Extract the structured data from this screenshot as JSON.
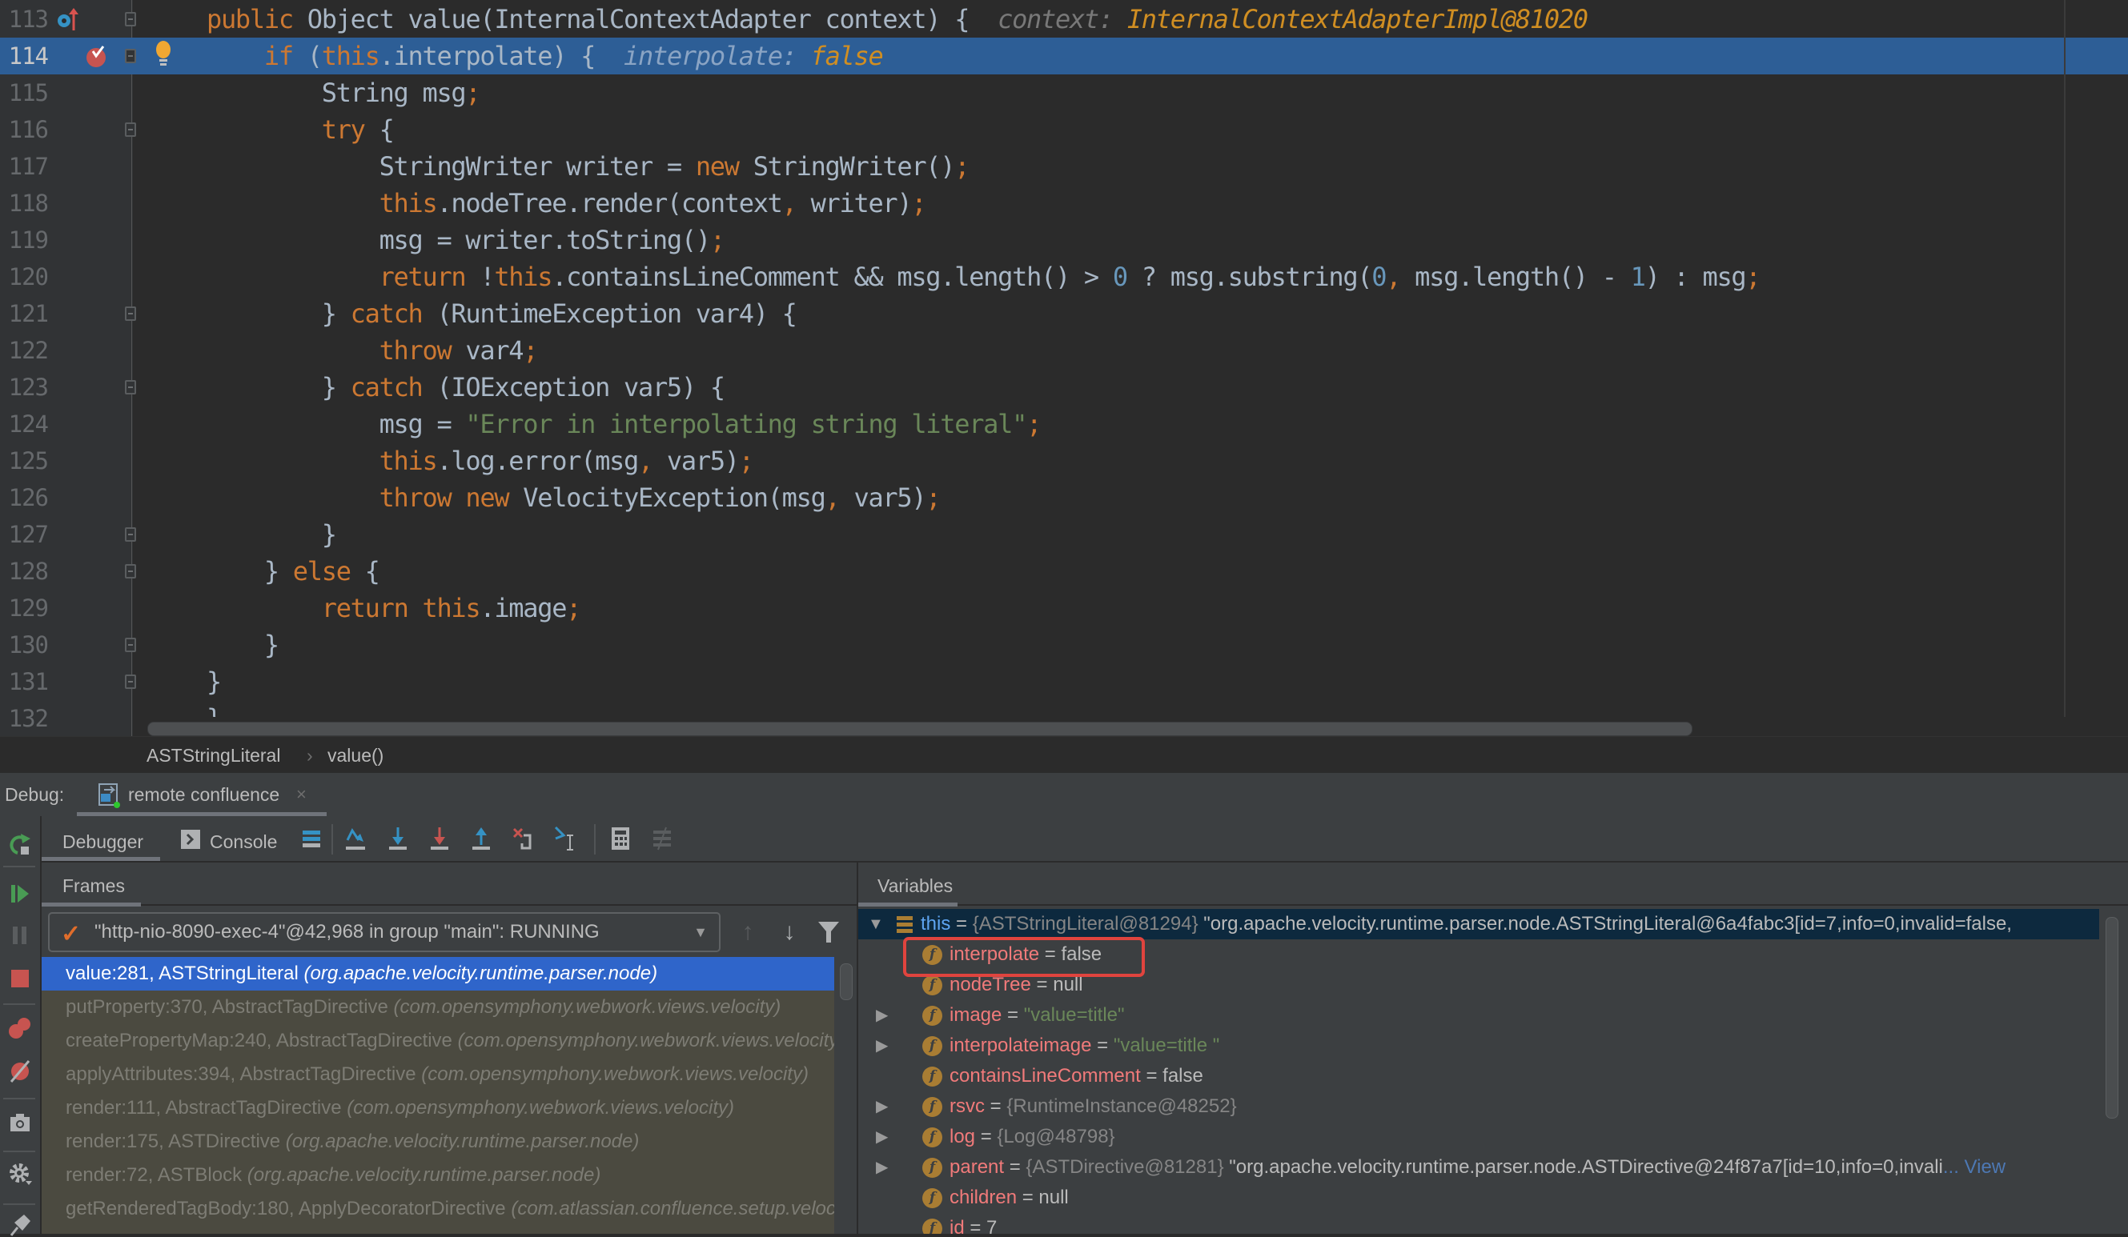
{
  "editor": {
    "lines": [
      {
        "num": "113",
        "tokens": [
          [
            "kw",
            "public "
          ],
          [
            "",
            "Object value(InternalContextAdapter context) {  "
          ],
          [
            "hint-name",
            "context: "
          ],
          [
            "hint-val",
            "InternalContextAdapterImpl@81020"
          ]
        ]
      },
      {
        "num": "114",
        "tokens": [
          [
            "",
            "    "
          ],
          [
            "kw",
            "if "
          ],
          [
            "",
            "("
          ],
          [
            "kw",
            "this"
          ],
          [
            "",
            ".interpolate) {  "
          ],
          [
            "hint-name",
            "interpolate: "
          ],
          [
            "hint-val",
            "false"
          ]
        ]
      },
      {
        "num": "115",
        "tokens": [
          [
            "",
            "        String msg"
          ],
          [
            "kw",
            ";"
          ]
        ]
      },
      {
        "num": "116",
        "tokens": [
          [
            "",
            "        "
          ],
          [
            "kw",
            "try "
          ],
          [
            "",
            "{"
          ]
        ]
      },
      {
        "num": "117",
        "tokens": [
          [
            "",
            "            StringWriter writer = "
          ],
          [
            "kw",
            "new "
          ],
          [
            "",
            "StringWriter()"
          ],
          [
            "kw",
            ";"
          ]
        ]
      },
      {
        "num": "118",
        "tokens": [
          [
            "",
            "            "
          ],
          [
            "kw",
            "this"
          ],
          [
            "",
            ".nodeTree.render(context"
          ],
          [
            "kw",
            ","
          ],
          [
            "",
            " writer)"
          ],
          [
            "kw",
            ";"
          ]
        ]
      },
      {
        "num": "119",
        "tokens": [
          [
            "",
            "            msg = writer.toString()"
          ],
          [
            "kw",
            ";"
          ]
        ]
      },
      {
        "num": "120",
        "tokens": [
          [
            "",
            "            "
          ],
          [
            "kw",
            "return "
          ],
          [
            "",
            "!"
          ],
          [
            "kw",
            "this"
          ],
          [
            "",
            ".containsLineComment && msg.length() > "
          ],
          [
            "num",
            "0"
          ],
          [
            "",
            " ? msg.substring("
          ],
          [
            "num",
            "0"
          ],
          [
            "kw",
            ","
          ],
          [
            "",
            " msg.length() - "
          ],
          [
            "num",
            "1"
          ],
          [
            "",
            ") : msg"
          ],
          [
            "kw",
            ";"
          ]
        ]
      },
      {
        "num": "121",
        "tokens": [
          [
            "",
            "        } "
          ],
          [
            "kw",
            "catch "
          ],
          [
            "",
            "(RuntimeException var4) {"
          ]
        ]
      },
      {
        "num": "122",
        "tokens": [
          [
            "",
            "            "
          ],
          [
            "kw",
            "throw "
          ],
          [
            "",
            "var4"
          ],
          [
            "kw",
            ";"
          ]
        ]
      },
      {
        "num": "123",
        "tokens": [
          [
            "",
            "        } "
          ],
          [
            "kw",
            "catch "
          ],
          [
            "",
            "(IOException var5) {"
          ]
        ]
      },
      {
        "num": "124",
        "tokens": [
          [
            "",
            "            msg = "
          ],
          [
            "str",
            "\"Error in interpolating string literal\""
          ],
          [
            "kw",
            ";"
          ]
        ]
      },
      {
        "num": "125",
        "tokens": [
          [
            "",
            "            "
          ],
          [
            "kw",
            "this"
          ],
          [
            "",
            ".log.error(msg"
          ],
          [
            "kw",
            ","
          ],
          [
            "",
            " var5)"
          ],
          [
            "kw",
            ";"
          ]
        ]
      },
      {
        "num": "126",
        "tokens": [
          [
            "",
            "            "
          ],
          [
            "kw",
            "throw new "
          ],
          [
            "",
            "VelocityException(msg"
          ],
          [
            "kw",
            ","
          ],
          [
            "",
            " var5)"
          ],
          [
            "kw",
            ";"
          ]
        ]
      },
      {
        "num": "127",
        "tokens": [
          [
            "",
            "        }"
          ]
        ]
      },
      {
        "num": "128",
        "tokens": [
          [
            "",
            "    } "
          ],
          [
            "kw",
            "else "
          ],
          [
            "",
            "{"
          ]
        ]
      },
      {
        "num": "129",
        "tokens": [
          [
            "",
            "        "
          ],
          [
            "kw",
            "return this"
          ],
          [
            "",
            ".image"
          ],
          [
            "kw",
            ";"
          ]
        ]
      },
      {
        "num": "130",
        "tokens": [
          [
            "",
            "    }"
          ]
        ]
      },
      {
        "num": "131",
        "tokens": [
          [
            "",
            "}"
          ]
        ]
      },
      {
        "num": "132",
        "tokens": [
          [
            "",
            "}"
          ]
        ]
      }
    ],
    "current_line": "114"
  },
  "breadcrumb": {
    "items": [
      "ASTStringLiteral",
      "value()"
    ],
    "separator": "›"
  },
  "debug": {
    "label": "Debug:",
    "session_tab": "remote confluence",
    "close_glyph": "×",
    "tabs": {
      "debugger": "Debugger",
      "console": "Console"
    },
    "frames": {
      "title": "Frames",
      "thread": "\"http-nio-8090-exec-4\"@42,968 in group \"main\": RUNNING",
      "items": [
        {
          "method": "value:281, ASTStringLiteral ",
          "pkg": "(org.apache.velocity.runtime.parser.node)",
          "selected": true
        },
        {
          "method": "putProperty:370, AbstractTagDirective ",
          "pkg": "(com.opensymphony.webwork.views.velocity)"
        },
        {
          "method": "createPropertyMap:240, AbstractTagDirective ",
          "pkg": "(com.opensymphony.webwork.views.velocity)"
        },
        {
          "method": "applyAttributes:394, AbstractTagDirective ",
          "pkg": "(com.opensymphony.webwork.views.velocity)"
        },
        {
          "method": "render:111, AbstractTagDirective ",
          "pkg": "(com.opensymphony.webwork.views.velocity)"
        },
        {
          "method": "render:175, ASTDirective ",
          "pkg": "(org.apache.velocity.runtime.parser.node)"
        },
        {
          "method": "render:72, ASTBlock ",
          "pkg": "(org.apache.velocity.runtime.parser.node)"
        },
        {
          "method": "getRenderedTagBody:180, ApplyDecoratorDirective ",
          "pkg": "(com.atlassian.confluence.setup.velocity)"
        }
      ]
    },
    "variables": {
      "title": "Variables",
      "items": [
        {
          "name": "this",
          "eq": " = ",
          "type": "{ASTStringLiteral@81294} ",
          "value": "\"org.apache.velocity.runtime.parser.node.ASTStringLiteral@6a4fabc3[id=7,info=0,invalid=false,",
          "expandable": true,
          "expanded": true,
          "kind": "this"
        },
        {
          "name": "interpolate",
          "eq": " = ",
          "value": "false",
          "kind": "field",
          "highlighted": true
        },
        {
          "name": "nodeTree",
          "eq": " = ",
          "value": "null",
          "kind": "field"
        },
        {
          "name": "image",
          "eq": " = ",
          "str": "\"value=title\"",
          "kind": "field",
          "expandable": true
        },
        {
          "name": "interpolateimage",
          "eq": " = ",
          "str": "\"value=title \"",
          "kind": "field",
          "expandable": true
        },
        {
          "name": "containsLineComment",
          "eq": " = ",
          "value": "false",
          "kind": "field"
        },
        {
          "name": "rsvc",
          "eq": " = ",
          "type": "{RuntimeInstance@48252}",
          "kind": "field",
          "expandable": true
        },
        {
          "name": "log",
          "eq": " = ",
          "type": "{Log@48798}",
          "kind": "field",
          "expandable": true
        },
        {
          "name": "parent",
          "eq": " = ",
          "type": "{ASTDirective@81281} ",
          "value": "\"org.apache.velocity.runtime.parser.node.ASTDirective@24f87a7[id=10,info=0,invali",
          "link": "... View",
          "kind": "field",
          "expandable": true
        },
        {
          "name": "children",
          "eq": " = ",
          "value": "null",
          "kind": "field"
        },
        {
          "name": "id",
          "eq": " = ",
          "value": "7",
          "kind": "field"
        }
      ]
    }
  },
  "colors": {
    "editor_bg": "#2b2b2b",
    "current_line": "#2d5e96",
    "keyword": "#cc7832",
    "number": "#6897bb",
    "string": "#6a8759",
    "selected_frame": "#2f65ca",
    "highlight_box": "#e0443e"
  }
}
